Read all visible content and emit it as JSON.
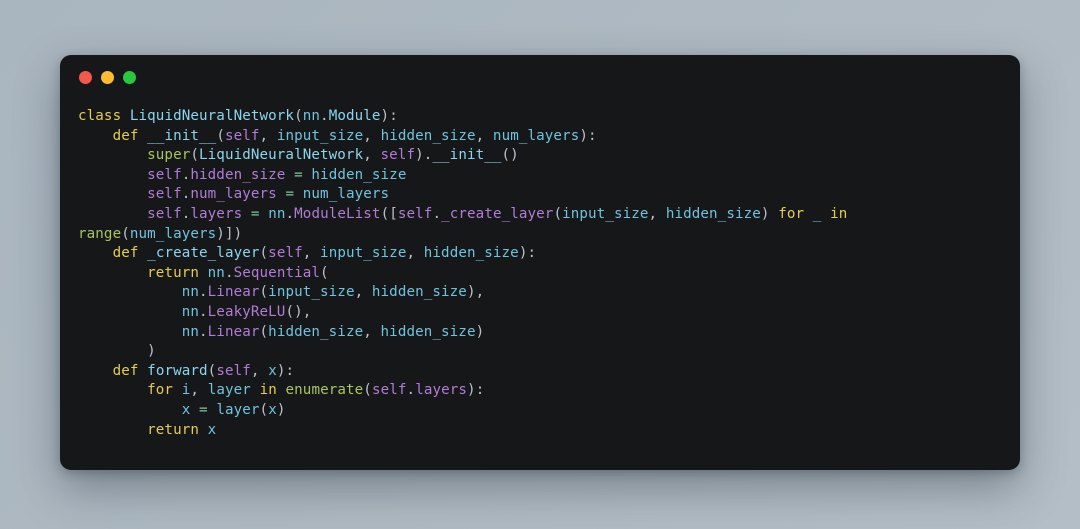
{
  "window": {
    "traffic_lights": [
      {
        "name": "close",
        "color": "#f4574c"
      },
      {
        "name": "minimize",
        "color": "#fbbd2e"
      },
      {
        "name": "maximize",
        "color": "#27c93f"
      }
    ],
    "background_color": "#161719",
    "page_background": "#aeb9c2"
  },
  "code": {
    "language": "python",
    "theme_colors": {
      "keyword": "#e5cd52",
      "class_name": "#8bd5ef",
      "variable": "#6fc3df",
      "self": "#b07cd6",
      "attribute": "#b07cd6",
      "builtin": "#a8c65a",
      "operator": "#7fc8a0",
      "punctuation": "#bcc2cc",
      "foreground": "#c8ccd4"
    },
    "lines": [
      "class LiquidNeuralNetwork(nn.Module):",
      "    def __init__(self, input_size, hidden_size, num_layers):",
      "        super(LiquidNeuralNetwork, self).__init__()",
      "        self.hidden_size = hidden_size",
      "        self.num_layers = num_layers",
      "        self.layers = nn.ModuleList([self._create_layer(input_size, hidden_size) for _ in range(num_layers)])",
      "    def _create_layer(self, input_size, hidden_size):",
      "        return nn.Sequential(",
      "            nn.Linear(input_size, hidden_size),",
      "            nn.LeakyReLU(),",
      "            nn.Linear(hidden_size, hidden_size)",
      "        )",
      "    def forward(self, x):",
      "        for i, layer in enumerate(self.layers):",
      "            x = layer(x)",
      "        return x"
    ],
    "tokens": [
      [
        [
          "kw",
          "class"
        ],
        [
          "plain",
          " "
        ],
        [
          "cls",
          "LiquidNeuralNetwork"
        ],
        [
          "punc",
          "("
        ],
        [
          "var",
          "nn"
        ],
        [
          "punc",
          "."
        ],
        [
          "cls",
          "Module"
        ],
        [
          "punc",
          "):"
        ]
      ],
      [
        [
          "plain",
          "    "
        ],
        [
          "kw",
          "def"
        ],
        [
          "plain",
          " "
        ],
        [
          "cls",
          "__init__"
        ],
        [
          "punc",
          "("
        ],
        [
          "self",
          "self"
        ],
        [
          "punc",
          ", "
        ],
        [
          "var",
          "input_size"
        ],
        [
          "punc",
          ", "
        ],
        [
          "var",
          "hidden_size"
        ],
        [
          "punc",
          ", "
        ],
        [
          "var",
          "num_layers"
        ],
        [
          "punc",
          "):"
        ]
      ],
      [
        [
          "plain",
          "        "
        ],
        [
          "fn",
          "super"
        ],
        [
          "punc",
          "("
        ],
        [
          "cls",
          "LiquidNeuralNetwork"
        ],
        [
          "punc",
          ", "
        ],
        [
          "self",
          "self"
        ],
        [
          "punc",
          ")."
        ],
        [
          "cls",
          "__init__"
        ],
        [
          "punc",
          "()"
        ]
      ],
      [
        [
          "plain",
          "        "
        ],
        [
          "self",
          "self"
        ],
        [
          "punc",
          "."
        ],
        [
          "self",
          "hidden_size"
        ],
        [
          "plain",
          " "
        ],
        [
          "op",
          "="
        ],
        [
          "plain",
          " "
        ],
        [
          "var",
          "hidden_size"
        ]
      ],
      [
        [
          "plain",
          "        "
        ],
        [
          "self",
          "self"
        ],
        [
          "punc",
          "."
        ],
        [
          "self",
          "num_layers"
        ],
        [
          "plain",
          " "
        ],
        [
          "op",
          "="
        ],
        [
          "plain",
          " "
        ],
        [
          "var",
          "num_layers"
        ]
      ],
      [
        [
          "plain",
          "        "
        ],
        [
          "self",
          "self"
        ],
        [
          "punc",
          "."
        ],
        [
          "self",
          "layers"
        ],
        [
          "plain",
          " "
        ],
        [
          "op",
          "="
        ],
        [
          "plain",
          " "
        ],
        [
          "var",
          "nn"
        ],
        [
          "punc",
          "."
        ],
        [
          "attr",
          "ModuleList"
        ],
        [
          "punc",
          "(["
        ],
        [
          "self",
          "self"
        ],
        [
          "punc",
          "."
        ],
        [
          "self",
          "_create_layer"
        ],
        [
          "punc",
          "("
        ],
        [
          "var",
          "input_size"
        ],
        [
          "punc",
          ", "
        ],
        [
          "var",
          "hidden_size"
        ],
        [
          "punc",
          ") "
        ],
        [
          "kw",
          "for"
        ],
        [
          "plain",
          " "
        ],
        [
          "var",
          "_"
        ],
        [
          "plain",
          " "
        ],
        [
          "kw",
          "in"
        ],
        [
          "plain",
          " "
        ],
        [
          "fn",
          "range"
        ],
        [
          "punc",
          "("
        ],
        [
          "var",
          "num_layers"
        ],
        [
          "punc",
          ")])"
        ]
      ],
      [
        [
          "plain",
          "    "
        ],
        [
          "kw",
          "def"
        ],
        [
          "plain",
          " "
        ],
        [
          "cls",
          "_create_layer"
        ],
        [
          "punc",
          "("
        ],
        [
          "self",
          "self"
        ],
        [
          "punc",
          ", "
        ],
        [
          "var",
          "input_size"
        ],
        [
          "punc",
          ", "
        ],
        [
          "var",
          "hidden_size"
        ],
        [
          "punc",
          "):"
        ]
      ],
      [
        [
          "plain",
          "        "
        ],
        [
          "kw",
          "return"
        ],
        [
          "plain",
          " "
        ],
        [
          "var",
          "nn"
        ],
        [
          "punc",
          "."
        ],
        [
          "attr",
          "Sequential"
        ],
        [
          "punc",
          "("
        ]
      ],
      [
        [
          "plain",
          "            "
        ],
        [
          "var",
          "nn"
        ],
        [
          "punc",
          "."
        ],
        [
          "attr",
          "Linear"
        ],
        [
          "punc",
          "("
        ],
        [
          "var",
          "input_size"
        ],
        [
          "punc",
          ", "
        ],
        [
          "var",
          "hidden_size"
        ],
        [
          "punc",
          "),"
        ]
      ],
      [
        [
          "plain",
          "            "
        ],
        [
          "var",
          "nn"
        ],
        [
          "punc",
          "."
        ],
        [
          "attr",
          "LeakyReLU"
        ],
        [
          "punc",
          "(),"
        ]
      ],
      [
        [
          "plain",
          "            "
        ],
        [
          "var",
          "nn"
        ],
        [
          "punc",
          "."
        ],
        [
          "attr",
          "Linear"
        ],
        [
          "punc",
          "("
        ],
        [
          "var",
          "hidden_size"
        ],
        [
          "punc",
          ", "
        ],
        [
          "var",
          "hidden_size"
        ],
        [
          "punc",
          ")"
        ]
      ],
      [
        [
          "plain",
          "        "
        ],
        [
          "punc",
          ")"
        ]
      ],
      [
        [
          "plain",
          "    "
        ],
        [
          "kw",
          "def"
        ],
        [
          "plain",
          " "
        ],
        [
          "cls",
          "forward"
        ],
        [
          "punc",
          "("
        ],
        [
          "self",
          "self"
        ],
        [
          "punc",
          ", "
        ],
        [
          "var",
          "x"
        ],
        [
          "punc",
          "):"
        ]
      ],
      [
        [
          "plain",
          "        "
        ],
        [
          "kw",
          "for"
        ],
        [
          "plain",
          " "
        ],
        [
          "var",
          "i"
        ],
        [
          "punc",
          ", "
        ],
        [
          "var",
          "layer"
        ],
        [
          "plain",
          " "
        ],
        [
          "kw",
          "in"
        ],
        [
          "plain",
          " "
        ],
        [
          "fn",
          "enumerate"
        ],
        [
          "punc",
          "("
        ],
        [
          "self",
          "self"
        ],
        [
          "punc",
          "."
        ],
        [
          "self",
          "layers"
        ],
        [
          "punc",
          "):"
        ]
      ],
      [
        [
          "plain",
          "            "
        ],
        [
          "var",
          "x"
        ],
        [
          "plain",
          " "
        ],
        [
          "op",
          "="
        ],
        [
          "plain",
          " "
        ],
        [
          "var",
          "layer"
        ],
        [
          "punc",
          "("
        ],
        [
          "var",
          "x"
        ],
        [
          "punc",
          ")"
        ]
      ],
      [
        [
          "plain",
          "        "
        ],
        [
          "kw",
          "return"
        ],
        [
          "plain",
          " "
        ],
        [
          "var",
          "x"
        ]
      ]
    ]
  }
}
